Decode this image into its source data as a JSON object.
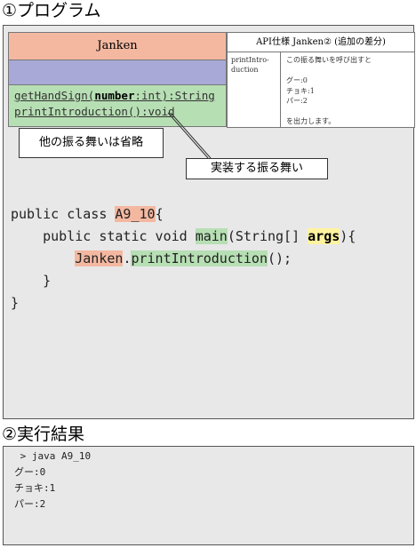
{
  "section1_title": "①プログラム",
  "section2_title": "②実行結果",
  "uml": {
    "class_name": "Janken",
    "op1_prefix": "getHandSign(",
    "op1_param": "number",
    "op1_suffix": ":int):String",
    "op2": "printIntroduction():void"
  },
  "api": {
    "title": "API仕様 Janken② (追加の差分)",
    "method_line1": "printIntro-",
    "method_line2": "duction",
    "desc_lines": [
      "この振る舞いを呼び出すと",
      "",
      "グー:0",
      "チョキ:1",
      "パー:2",
      "",
      "を出力します。"
    ]
  },
  "callouts": {
    "omitted": "他の振る舞いは省略",
    "implement": "実装する振る舞い"
  },
  "code": {
    "l1_a": "public class ",
    "l1_class": "A9_10",
    "l1_b": "{",
    "l2_a": "    public static void ",
    "l2_main": "main",
    "l2_b": "(String[] ",
    "l2_args": "args",
    "l2_c": "){",
    "l3_indent": "        ",
    "l3_cls": "Janken",
    "l3_dot": ".",
    "l3_method": "printIntroduction",
    "l3_end": "();",
    "l4": "    }",
    "l5": "}"
  },
  "output": {
    "command": " > java A9_10",
    "lines": [
      "グー:0",
      "チョキ:1",
      "パー:2"
    ]
  },
  "colors": {
    "class_header": "#f4b8a1",
    "attributes": "#a9a9d8",
    "operations": "#b7dfb4",
    "args_highlight": "#fff3a0",
    "panel_bg": "#e8e8e8"
  }
}
